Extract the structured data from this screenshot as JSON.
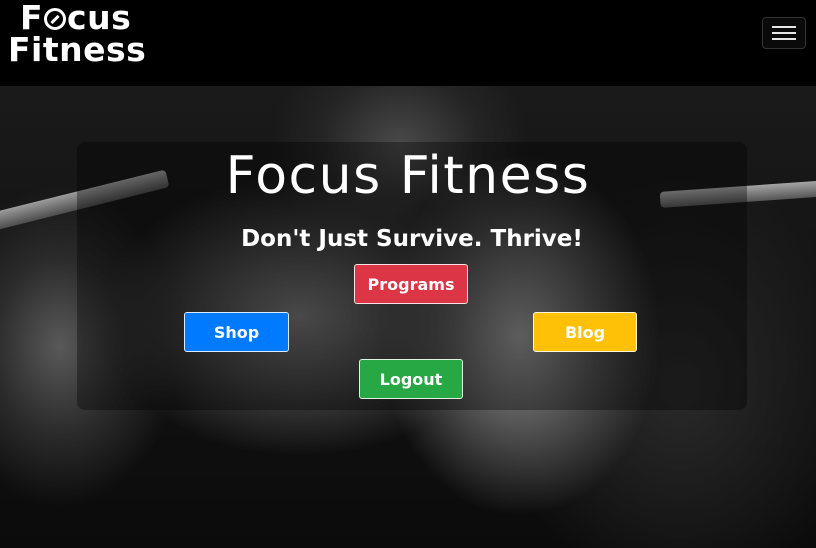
{
  "navbar": {
    "brand_line1_pre": "F",
    "brand_line1_post": "cus",
    "brand_line2": "Fitness",
    "menu_icon": "hamburger-icon"
  },
  "hero": {
    "title": "Focus Fitness",
    "subtitle": "Don't Just Survive. Thrive!",
    "background_image": "woman-lifting-barbell-gym-photo"
  },
  "buttons": {
    "programs": "Programs",
    "shop": "Shop",
    "blog": "Blog",
    "logout": "Logout"
  },
  "colors": {
    "programs": "#dc3545",
    "shop": "#007bff",
    "blog": "#ffc107",
    "logout": "#28a745",
    "navbar": "#000000"
  }
}
